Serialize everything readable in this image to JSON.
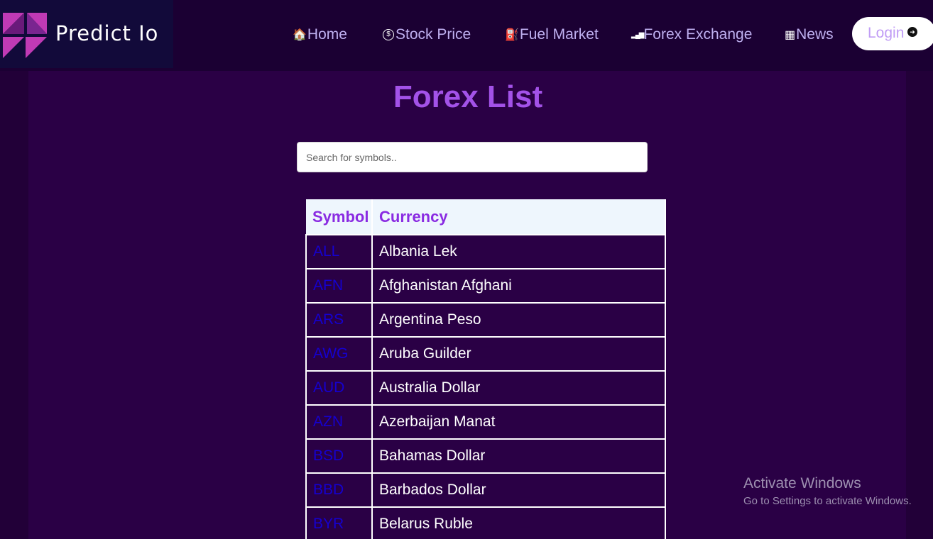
{
  "header": {
    "brand": "Predict Io",
    "nav": [
      {
        "icon": "home-icon",
        "glyph": "🏠",
        "label": "Home"
      },
      {
        "icon": "dollar-circle-icon",
        "glyph": "$",
        "label": "Stock Price"
      },
      {
        "icon": "fuel-pump-icon",
        "glyph": "⛽",
        "label": "Fuel Market"
      },
      {
        "icon": "bar-chart-icon",
        "glyph": "▂▄▆",
        "label": "Forex Exchange"
      },
      {
        "icon": "newspaper-icon",
        "glyph": "▦",
        "label": "News"
      }
    ],
    "login_label": "Login",
    "login_icon": "arrow-circle-right-icon"
  },
  "main": {
    "title": "Forex List",
    "search_placeholder": "Search for symbols..",
    "table": {
      "headers": [
        "Symbol",
        "Currency"
      ],
      "rows": [
        {
          "symbol": "ALL",
          "currency": "Albania Lek"
        },
        {
          "symbol": "AFN",
          "currency": "Afghanistan Afghani"
        },
        {
          "symbol": "ARS",
          "currency": "Argentina Peso"
        },
        {
          "symbol": "AWG",
          "currency": "Aruba Guilder"
        },
        {
          "symbol": "AUD",
          "currency": "Australia Dollar"
        },
        {
          "symbol": "AZN",
          "currency": "Azerbaijan Manat"
        },
        {
          "symbol": "BSD",
          "currency": "Bahamas Dollar"
        },
        {
          "symbol": "BBD",
          "currency": "Barbados Dollar"
        },
        {
          "symbol": "BYR",
          "currency": "Belarus Ruble"
        }
      ]
    }
  },
  "watermark": {
    "title": "Activate Windows",
    "subtitle": "Go to Settings to activate Windows."
  },
  "colors": {
    "background": "#2a0045",
    "header": "#1b0033",
    "title": "#a352e8",
    "symbol_link": "#1500d0",
    "nav_text": "#bfb0f0"
  }
}
